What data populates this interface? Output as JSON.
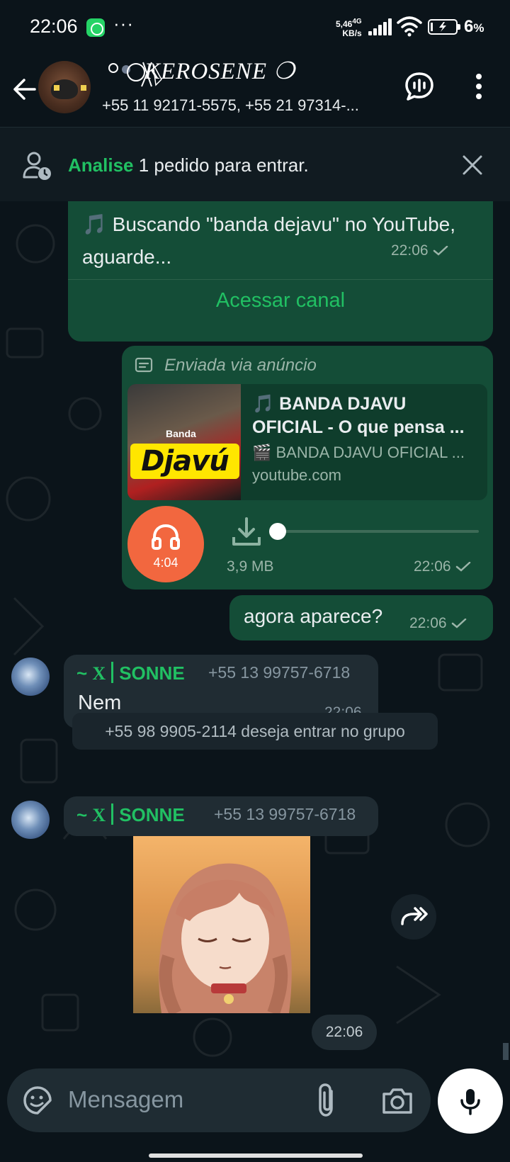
{
  "status_bar": {
    "time": "22:06",
    "dots": "···",
    "net_speed": "5,46",
    "net_unit": "KB/s",
    "net_type": "4G",
    "battery_percent": "6",
    "battery_unit": "%"
  },
  "header": {
    "group_name": "KEROSENE ❍",
    "participants": "+55 11 92171-5575, +55 21 97314-..."
  },
  "join_banner": {
    "accent": "Analise",
    "text": " 1 pedido para entrar."
  },
  "messages": [
    {
      "text": "🎵 Buscando \"banda dejavu\" no YouTube, aguarde...",
      "time": "22:06",
      "link_label": "Acessar canal"
    },
    {
      "via": "Enviada via anúncio",
      "preview_title": "🎵 BANDA DJAVU OFICIAL - O que pensa ...",
      "preview_desc": "🎬 BANDA DJAVU OFICIAL ...",
      "preview_domain": "youtube.com",
      "thumb_band": "Banda",
      "thumb_logo": "Djavú",
      "audio_duration": "4:04",
      "audio_progress": 0.0,
      "file_size": "3,9 MB",
      "time": "22:06"
    },
    {
      "text": "agora aparece?",
      "time": "22:06"
    },
    {
      "sender_prefix": "~ ",
      "sender_x": "X",
      "sender_name": "SONNE",
      "phone": "+55 13 99757-6718",
      "text": "Nem",
      "time": "22:06"
    },
    {
      "system": "+55 98 9905-2114 deseja entrar no grupo"
    },
    {
      "sender_prefix": "~ ",
      "sender_x": "X",
      "sender_name": "SONNE",
      "phone": "+55 13 99757-6718",
      "time": "22:06"
    }
  ],
  "composer": {
    "placeholder": "Mensagem"
  },
  "icons": {
    "back": "arrow-left-icon",
    "call": "voice-chat-icon",
    "menu": "more-vertical-icon",
    "join_request": "person-clock-icon",
    "close": "close-icon",
    "download": "download-icon",
    "headphones": "headphones-icon",
    "forward": "forward-icon",
    "emoji": "sticker-icon",
    "attach": "paperclip-icon",
    "camera": "camera-icon",
    "mic": "mic-icon"
  },
  "colors": {
    "accent_green": "#21c063",
    "outgoing_bubble": "#144d37",
    "incoming_bubble": "#202c33",
    "audio_orange": "#f2673f",
    "background": "#0b141a"
  }
}
